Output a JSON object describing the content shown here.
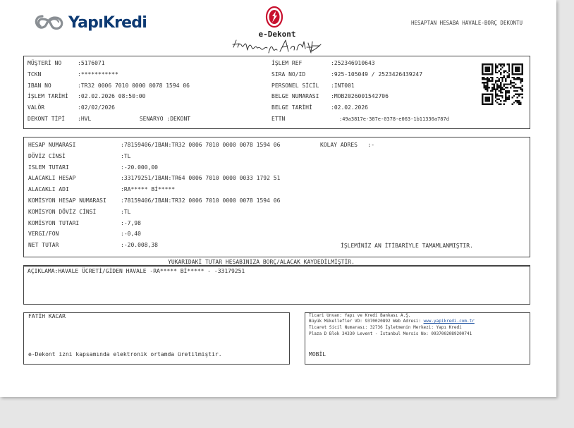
{
  "header": {
    "bank_name": "YapıKredi",
    "doc_title": "e-Dekont",
    "doc_type": "HESAPTAN HESABA HAVALE-BORÇ DEKONTU"
  },
  "info_left": [
    {
      "label": "MÜŞTERİ NO",
      "value": "5176071"
    },
    {
      "label": "TCKN",
      "value": "***********"
    },
    {
      "label": "IBAN NO",
      "value": "TR32 0006 7010 0000 0078 1594 06"
    },
    {
      "label": "İŞLEM TARİHİ",
      "value": "02.02.2026 08:50:00"
    },
    {
      "label": "VALÖR",
      "value": "02/02/2026"
    },
    {
      "label": "DEKONT TİPİ",
      "value": "HVL",
      "extra_label": "SENARYO",
      "extra_value": "DEKONT"
    }
  ],
  "info_right": [
    {
      "label": "İŞLEM REF",
      "value": "252346910643"
    },
    {
      "label": "SIRA NO/ID",
      "value": "925-105049 / 2523426439247"
    },
    {
      "label": "PERSONEL SİCİL",
      "value": "INT001"
    },
    {
      "label": "BELGE NUMARASI",
      "value": "MOB2026001542706"
    },
    {
      "label": "BELGE TARİHİ",
      "value": "02.02.2026"
    },
    {
      "label": "ETTN",
      "value": "49a3817e-387e-0378-e063-1b11330a787d"
    }
  ],
  "details": [
    {
      "label": "HESAP NUMARASI",
      "value": "78159406/IBAN:TR32 0006 7010 0000 0078 1594 06"
    },
    {
      "label": "DÖVİZ CİNSİ",
      "value": "TL"
    },
    {
      "label": "ISLEM TUTARI",
      "value": "-20.000,00"
    },
    {
      "label": "ALACAKLI HESAP",
      "value": "33179251/IBAN:TR64 0006 7010 0000 0033 1792 51"
    },
    {
      "label": "ALACAKLI ADI",
      "value": "RA***** Bİ*****"
    },
    {
      "label": "KOMİSYON HESAP NUMARASI",
      "value": "78159406/IBAN:TR32 0006 7010 0000 0078 1594 06"
    },
    {
      "label": "KOMİSYON DÖVİZ CİNSİ",
      "value": "TL"
    },
    {
      "label": "KOMİSYON TUTARI",
      "value": "-7,98"
    },
    {
      "label": "VERGI/FON",
      "value": "-0,40"
    },
    {
      "label": "NET TUTAR",
      "value": "-20.008,38"
    }
  ],
  "kolay_adres": {
    "label": "KOLAY ADRES",
    "value": "-"
  },
  "status_message": "İŞLEMİNİZ AN İTİBARİYLE TAMAMLANMIŞTIR.",
  "summary_line": "YUKARIDAKİ TUTAR HESABINIZA BORÇ/ALACAK KAYDEDİLMİŞTİR.",
  "description": "AÇIKLAMA:HAVALE ÜCRETİ/GİDEN HAVALE -RA***** Bİ*****  - -33179251",
  "footer_left": {
    "name": "FATİH KACAR",
    "note": "e-Dekont izni kapsamında elektronik ortamda üretilmiştir."
  },
  "footer_right": {
    "line1": "Ticari Unvan: Yapı ve Kredi Bankası A.Ş.",
    "line2_prefix": "Büyük Mükellefler VD: 9370020892 Web Adresi: ",
    "line2_link": "www.yapikredi.com.tr",
    "line3": "Ticaret Sicil Numarası: 32736 İşletmenin Merkezi: Yapı Kredi",
    "line4": "Plaza D Blok 34330 Levent - İstanbul Mersis No: 0937002089200741",
    "channel": "MOBİL"
  },
  "colors": {
    "brand_blue": "#0d3a73",
    "emblem_red": "#c8102e"
  }
}
